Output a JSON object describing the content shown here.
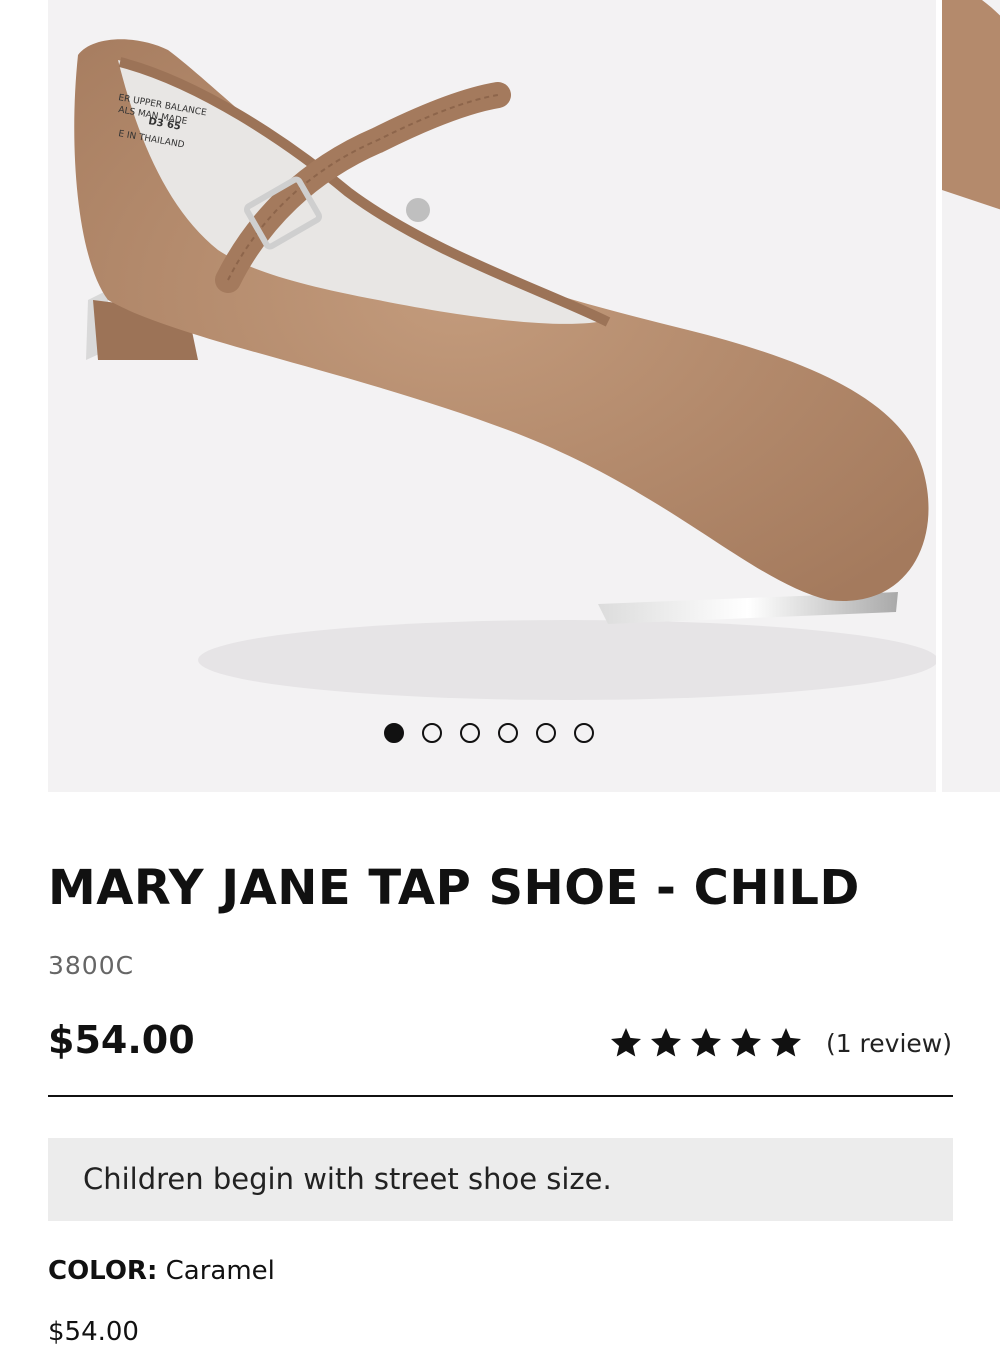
{
  "gallery": {
    "slide_count": 6,
    "active_index": 0,
    "image_alt": "Mary Jane tap shoe in caramel",
    "shoe_color": "#b48a6c"
  },
  "product": {
    "title": "MARY JANE TAP SHOE - CHILD",
    "sku": "3800C",
    "price": "$54.00"
  },
  "rating": {
    "stars": 5,
    "review_text": "(1 review)"
  },
  "notice": {
    "text": "Children begin with street shoe size."
  },
  "color": {
    "label": "COLOR:",
    "value": "Caramel"
  },
  "variant": {
    "price": "$54.00"
  },
  "colors": {
    "text": "#111111",
    "muted": "#666666",
    "gallery_bg": "#f3f2f3",
    "notice_bg": "#ececec"
  }
}
